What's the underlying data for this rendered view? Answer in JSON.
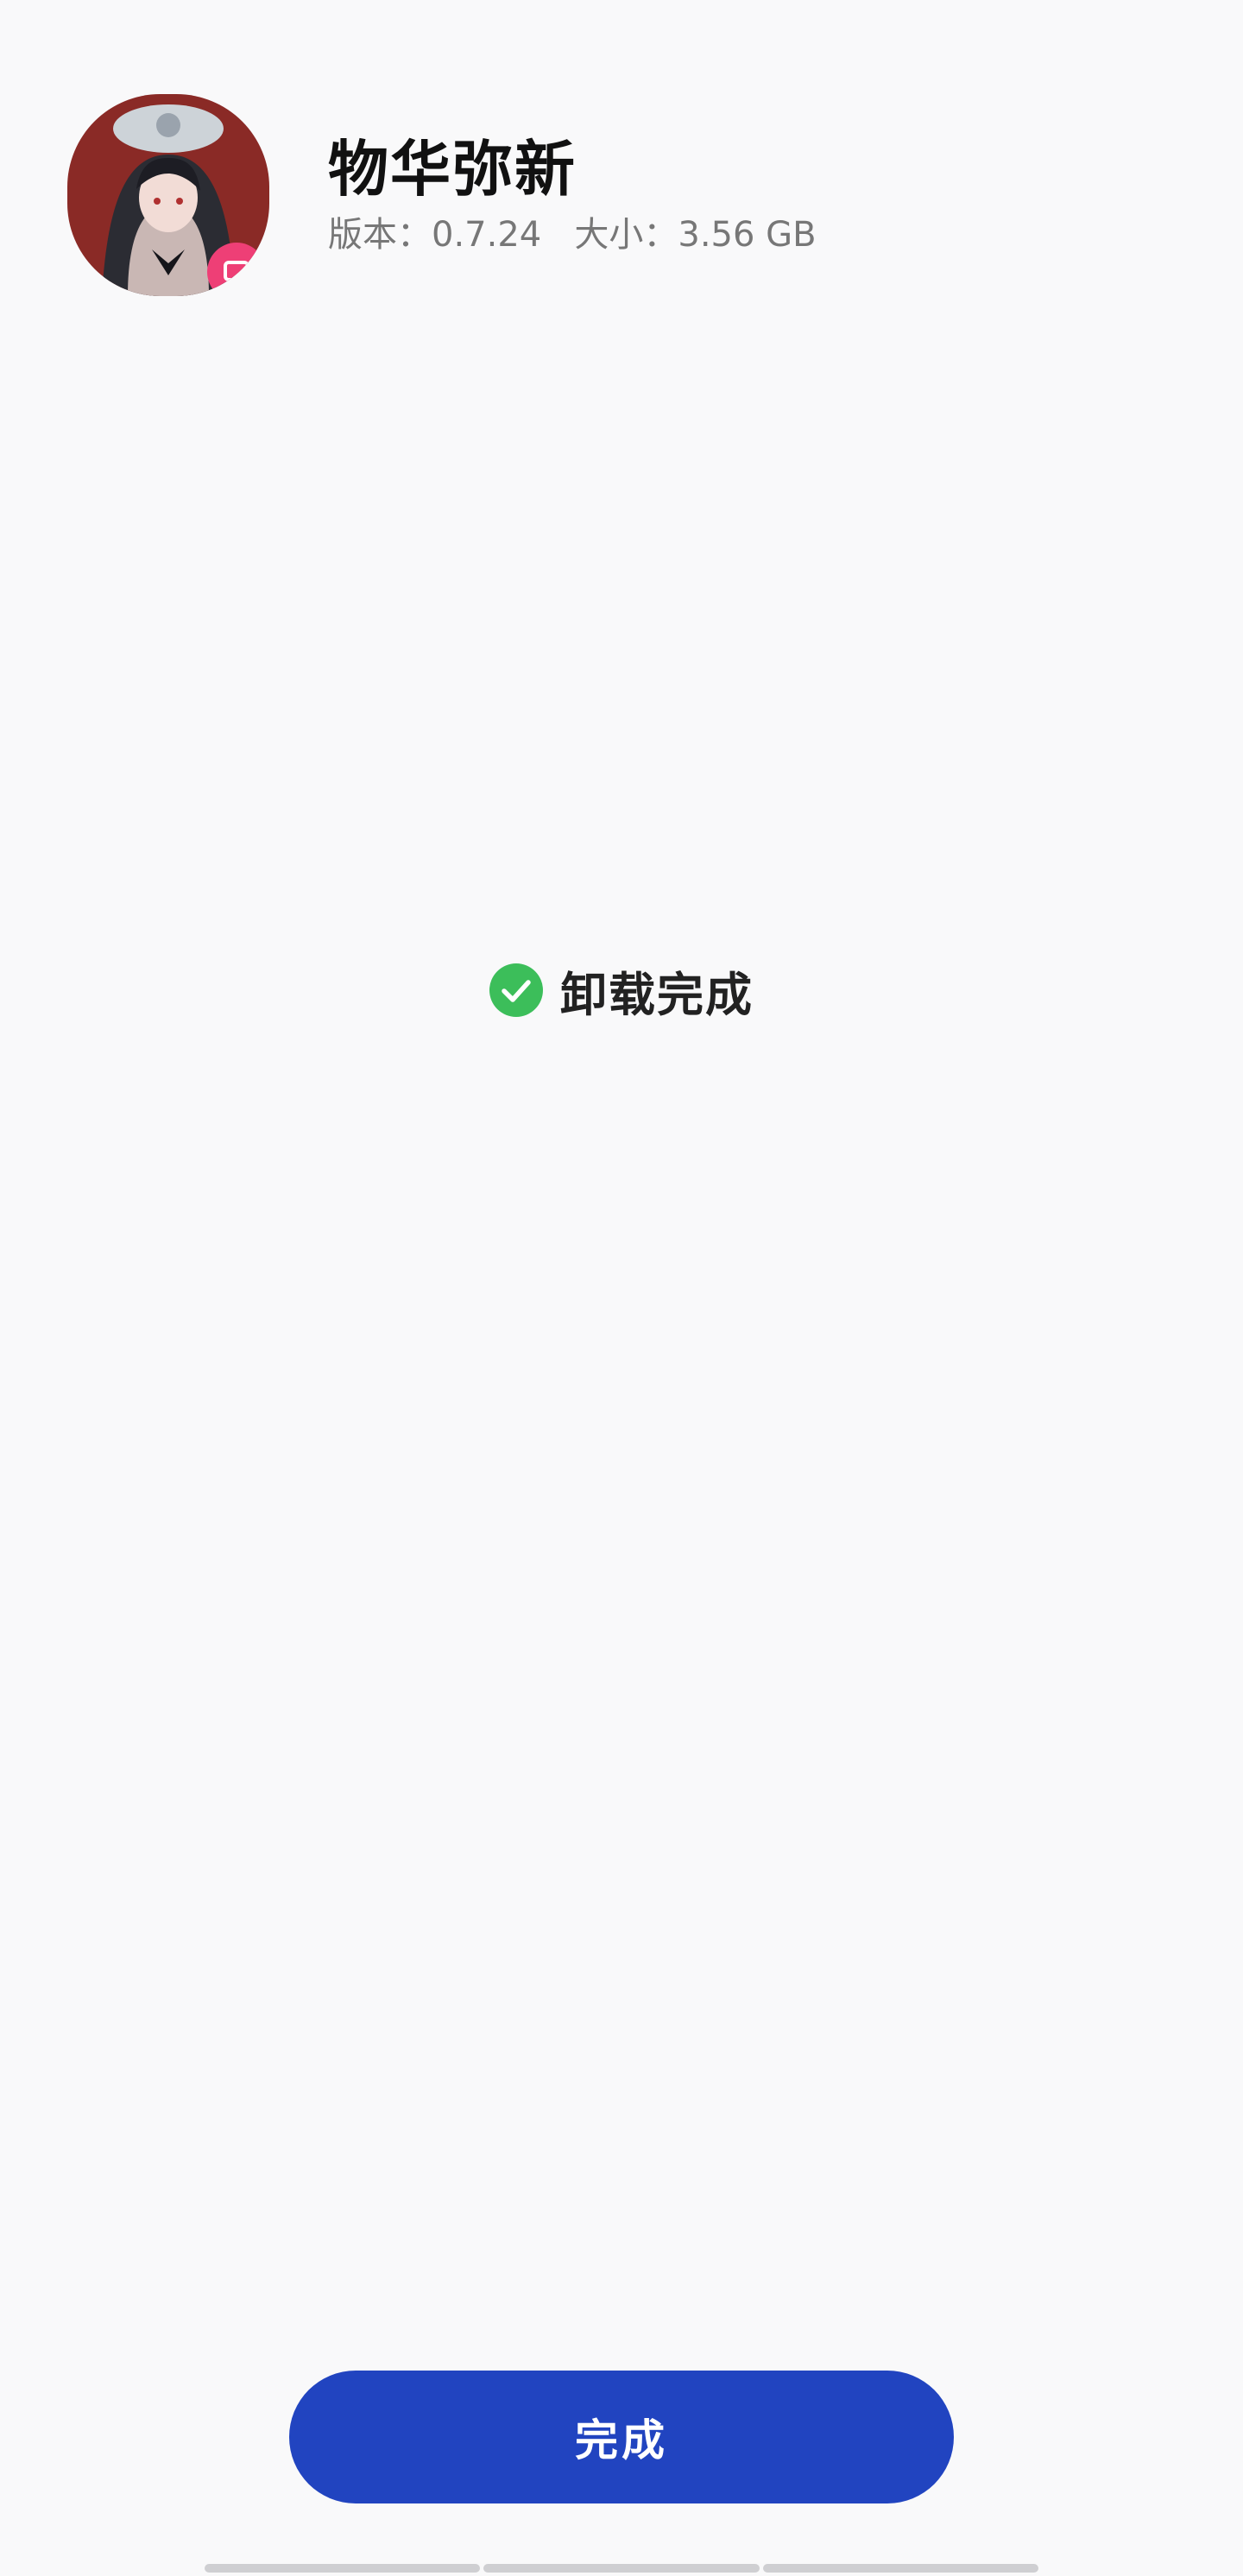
{
  "app": {
    "name": "物华弥新",
    "version_label": "版本：",
    "version": "0.7.24",
    "size_label": "大小：",
    "size": "3.56 GB",
    "icon": "app-icon-character-portrait"
  },
  "status": {
    "text": "卸载完成",
    "icon": "check-circle-icon",
    "color": "#3cbe5a"
  },
  "actions": {
    "done_label": "完成",
    "accent_color": "#2144c0"
  }
}
